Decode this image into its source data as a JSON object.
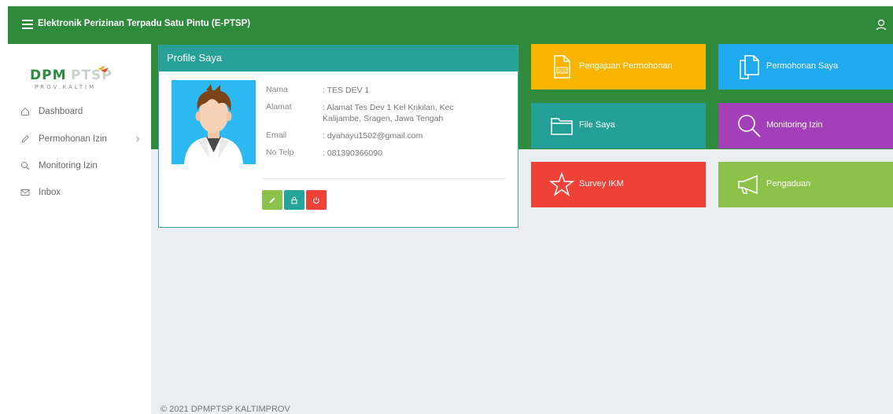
{
  "header": {
    "title": "Elektronik Perizinan Terpadu Satu Pintu (E-PTSP)"
  },
  "logo": {
    "top": "DPMPTSP",
    "bottom": "PROV.KALTIM"
  },
  "sidebar": {
    "items": [
      {
        "label": "Dashboard",
        "icon": "home-icon"
      },
      {
        "label": "Permohonan Izin",
        "icon": "pencil-icon"
      },
      {
        "label": "Monitoring Izin",
        "icon": "search-icon"
      },
      {
        "label": "Inbox",
        "icon": "mail-icon"
      }
    ]
  },
  "profile": {
    "heading": "Profile Saya",
    "rows": [
      {
        "label": "Nama",
        "value": ": TES DEV 1"
      },
      {
        "label": "Alamat",
        "value": ": Alamat Tes Dev 1 Kel Krikilan, Kec Kalijambe, Sragen, Jawa Tengah"
      },
      {
        "label": "Email",
        "value": ": dyahayu1502@gmail.com"
      },
      {
        "label": "No Telp",
        "value": ": 081390366090"
      }
    ]
  },
  "tiles": [
    {
      "label": "Pengajuan Permohonan",
      "color": "#f8b500",
      "icon": "doc-file-icon"
    },
    {
      "label": "Permohonan Saya",
      "color": "#1fa9ef",
      "icon": "copy-files-icon"
    },
    {
      "label": "File Saya",
      "color": "#239f96",
      "icon": "folder-icon"
    },
    {
      "label": "Monitoring Izin",
      "color": "#a33fb8",
      "icon": "search-icon"
    },
    {
      "label": "Survey IKM",
      "color": "#ee4138",
      "icon": "star-icon"
    },
    {
      "label": "Pengaduan",
      "color": "#8cc24a",
      "icon": "megaphone-icon"
    }
  ],
  "footer": {
    "text": "© 2021 DPMPTSP KALTIMPROV"
  }
}
